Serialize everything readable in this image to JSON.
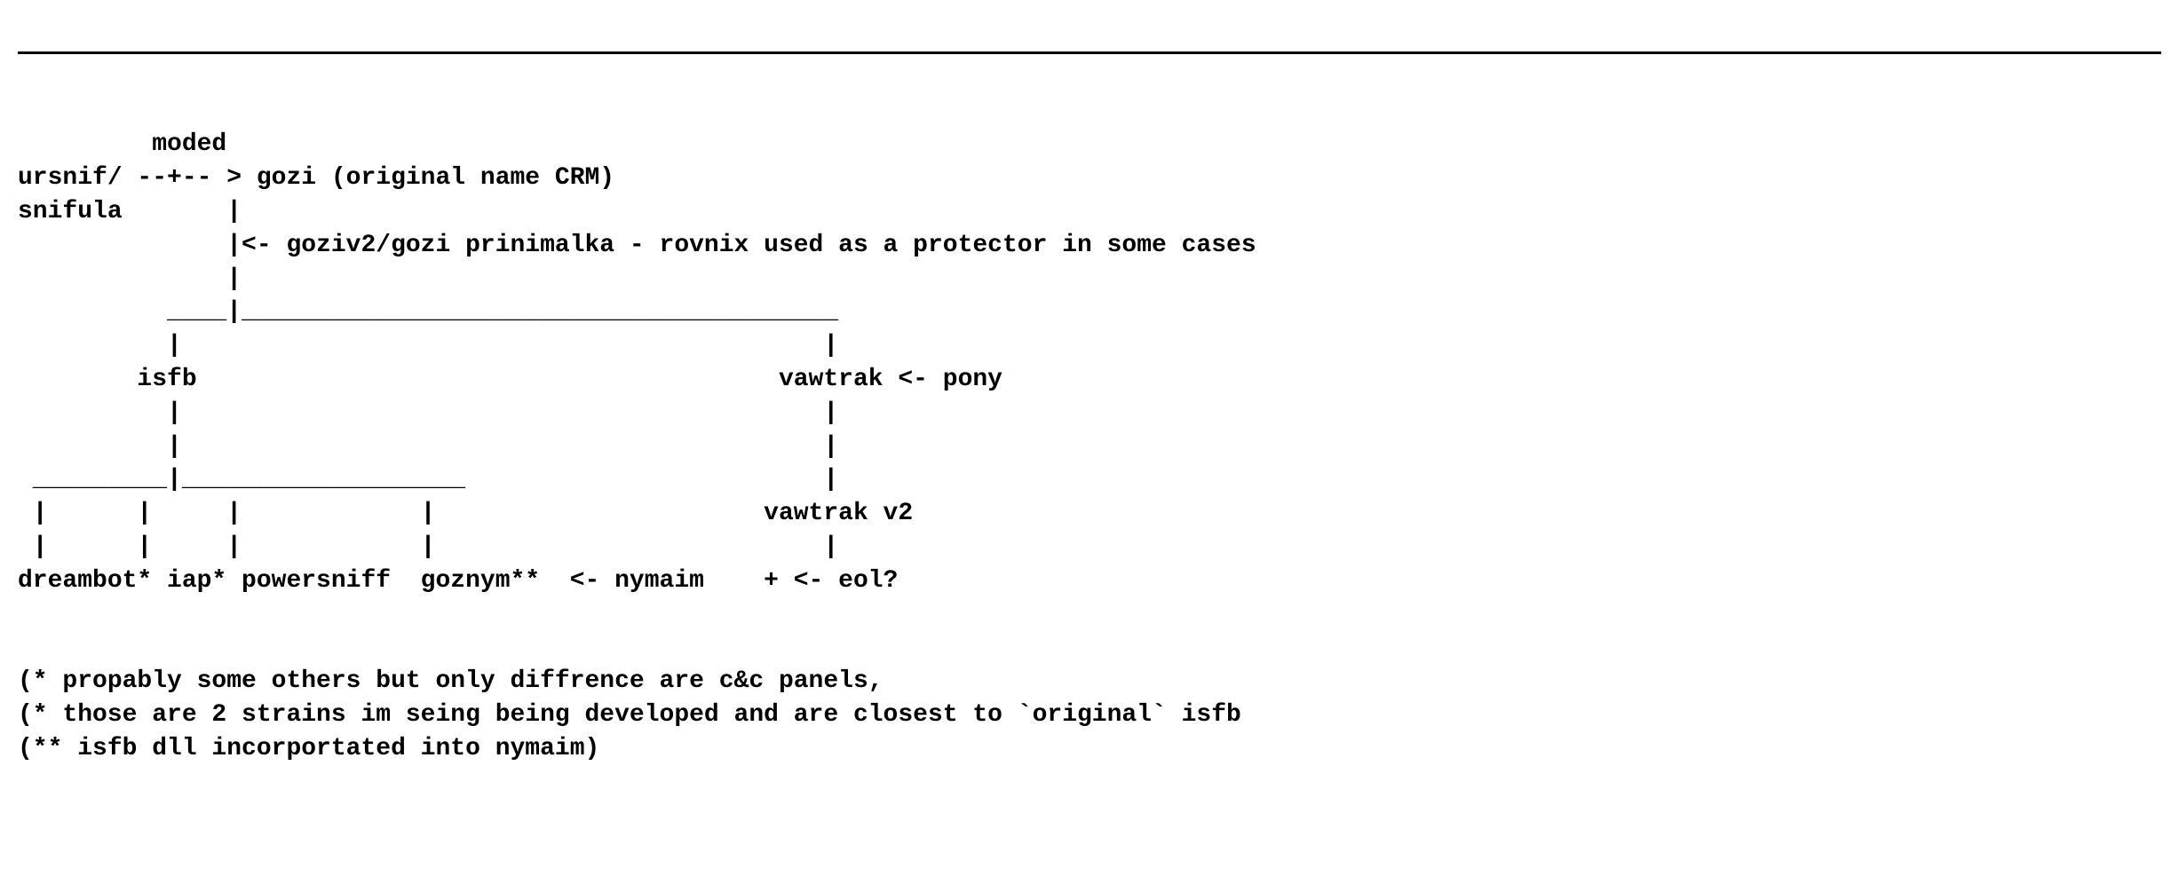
{
  "lines": {
    "l01": "         moded",
    "l02": "ursnif/ --+-- > gozi (original name CRM)",
    "l03": "snifula       |",
    "l04": "              |<- goziv2/gozi prinimalka - rovnix used as a protector in some cases",
    "l05": "              |",
    "l06": "          ____|________________________________________",
    "l07": "          |                                           |",
    "l08": "        isfb                                       vawtrak <- pony",
    "l09": "          |                                           |",
    "l10": "          |                                           |",
    "l11": " _________|___________________                        |",
    "l12": " |      |     |            |                      vawtrak v2",
    "l13": " |      |     |            |                          |",
    "l14": "dreambot* iap* powersniff  goznym**  <- nymaim    + <- eol?",
    "l15": "",
    "l16": "",
    "l17": "(* propably some others but only diffrence are c&c panels,",
    "l18": "(* those are 2 strains im seing being developed and are closest to `original` isfb",
    "l19": "(** isfb dll incorportated into nymaim)"
  }
}
